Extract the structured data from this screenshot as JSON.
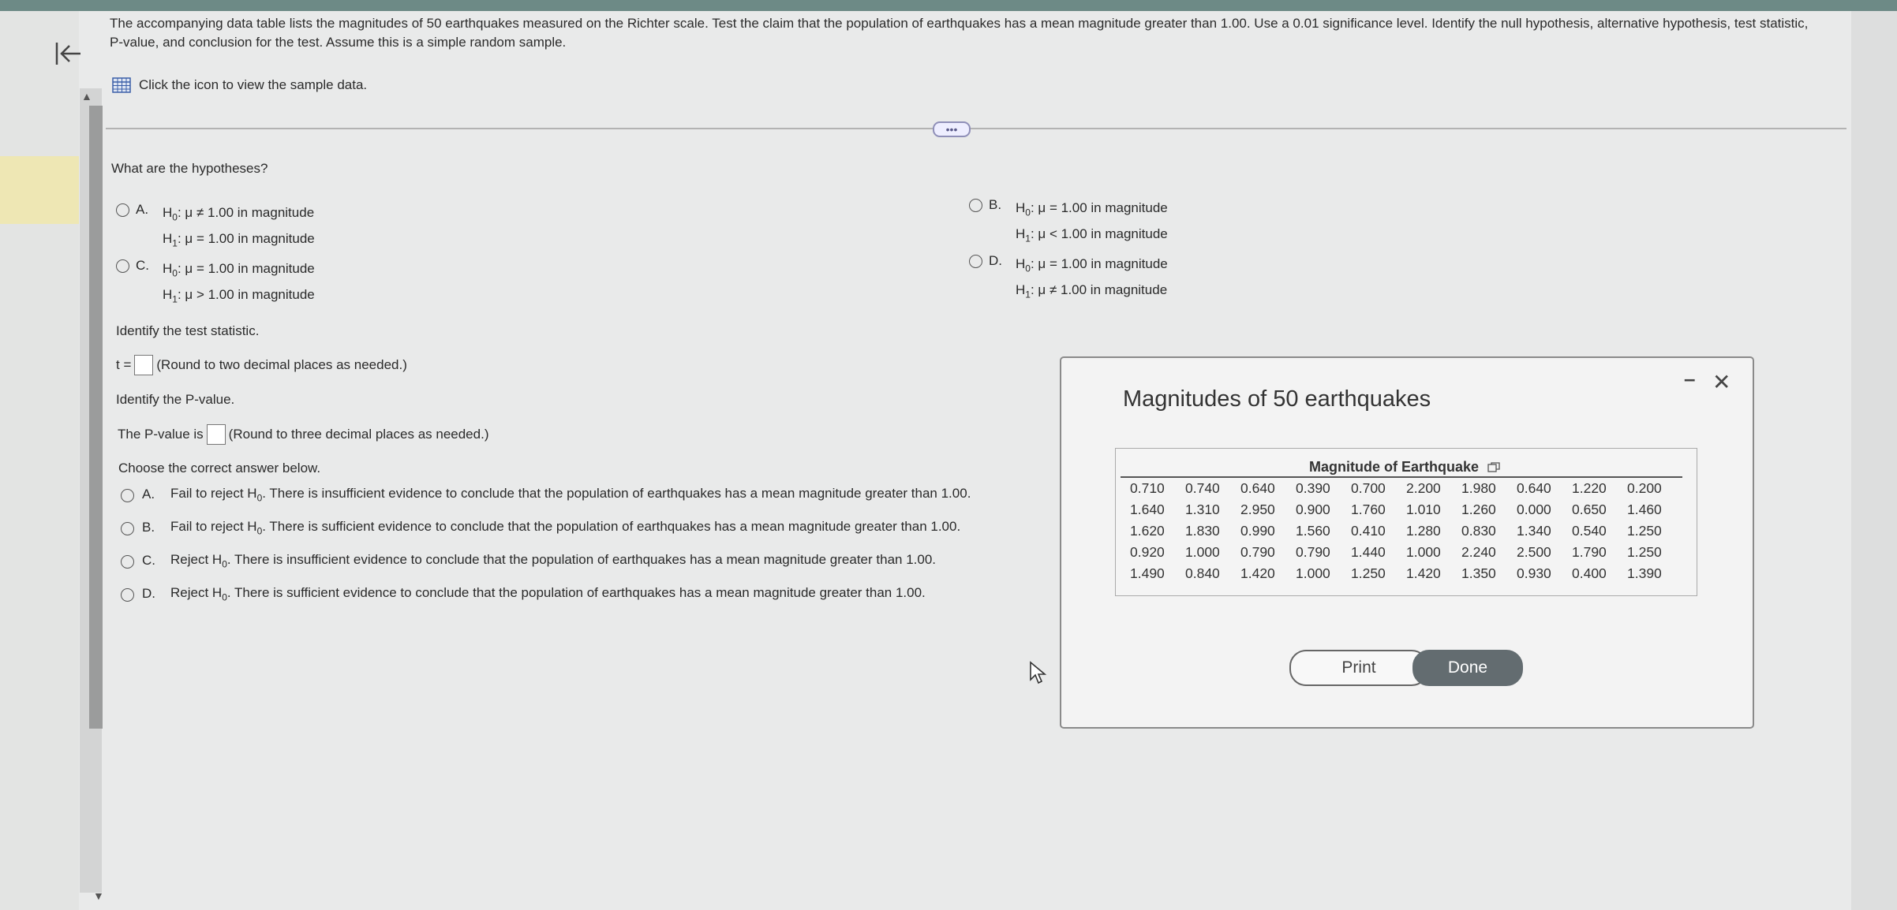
{
  "question": {
    "intro": "The accompanying data table lists the magnitudes of 50 earthquakes measured on the Richter scale. Test the claim that the population of earthquakes has a mean magnitude greater than 1.00. Use a 0.01 significance level. Identify the null hypothesis, alternative hypothesis, test statistic, P-value, and conclusion for the test. Assume this is a simple random sample.",
    "sample_link": "Click the icon to view the sample data."
  },
  "hypotheses": {
    "prompt": "What are the hypotheses?",
    "options": [
      {
        "letter": "A.",
        "h0": "μ ≠ 1.00 in magnitude",
        "h1": "μ = 1.00 in magnitude"
      },
      {
        "letter": "B.",
        "h0": "μ = 1.00 in magnitude",
        "h1": "μ < 1.00 in magnitude"
      },
      {
        "letter": "C.",
        "h0": "μ = 1.00 in magnitude",
        "h1": "μ > 1.00 in magnitude"
      },
      {
        "letter": "D.",
        "h0": "μ = 1.00 in magnitude",
        "h1": "μ ≠ 1.00 in magnitude"
      }
    ]
  },
  "test_stat": {
    "prompt": "Identify the test statistic.",
    "label": "t =",
    "hint": "(Round to two decimal places as needed.)"
  },
  "p_value": {
    "prompt": "Identify the P-value.",
    "label": "The P-value is",
    "hint": "(Round to three decimal places as needed.)"
  },
  "conclusion": {
    "prompt": "Choose the correct answer below.",
    "options": [
      {
        "letter": "A.",
        "pre": "Fail to reject H",
        "post": ". There is insufficient evidence to conclude that the population of earthquakes has a mean magnitude greater than 1.00."
      },
      {
        "letter": "B.",
        "pre": "Fail to reject H",
        "post": ". There is sufficient evidence to conclude that the population of earthquakes has a mean magnitude greater than 1.00."
      },
      {
        "letter": "C.",
        "pre": "Reject H",
        "post": ". There is insufficient evidence to conclude that the population of earthquakes has a mean magnitude greater than 1.00."
      },
      {
        "letter": "D.",
        "pre": "Reject H",
        "post": ". There is sufficient evidence to conclude that the population of earthquakes has a mean magnitude greater than 1.00."
      }
    ]
  },
  "dialog": {
    "title": "Magnitudes of 50 earthquakes",
    "table_header": "Magnitude of Earthquake",
    "rows": [
      [
        "0.710",
        "0.740",
        "0.640",
        "0.390",
        "0.700",
        "2.200",
        "1.980",
        "0.640",
        "1.220",
        "0.200"
      ],
      [
        "1.640",
        "1.310",
        "2.950",
        "0.900",
        "1.760",
        "1.010",
        "1.260",
        "0.000",
        "0.650",
        "1.460"
      ],
      [
        "1.620",
        "1.830",
        "0.990",
        "1.560",
        "0.410",
        "1.280",
        "0.830",
        "1.340",
        "0.540",
        "1.250"
      ],
      [
        "0.920",
        "1.000",
        "0.790",
        "0.790",
        "1.440",
        "1.000",
        "2.240",
        "2.500",
        "1.790",
        "1.250"
      ],
      [
        "1.490",
        "0.840",
        "1.420",
        "1.000",
        "1.250",
        "1.420",
        "1.350",
        "0.930",
        "0.400",
        "1.390"
      ]
    ],
    "print_label": "Print",
    "done_label": "Done"
  },
  "icons": {
    "back": "back-arrow-icon",
    "grid": "grid-icon",
    "copy": "copy-icon",
    "minimize": "minimize-icon",
    "close": "close-icon",
    "cursor": "mouse-cursor-icon"
  }
}
